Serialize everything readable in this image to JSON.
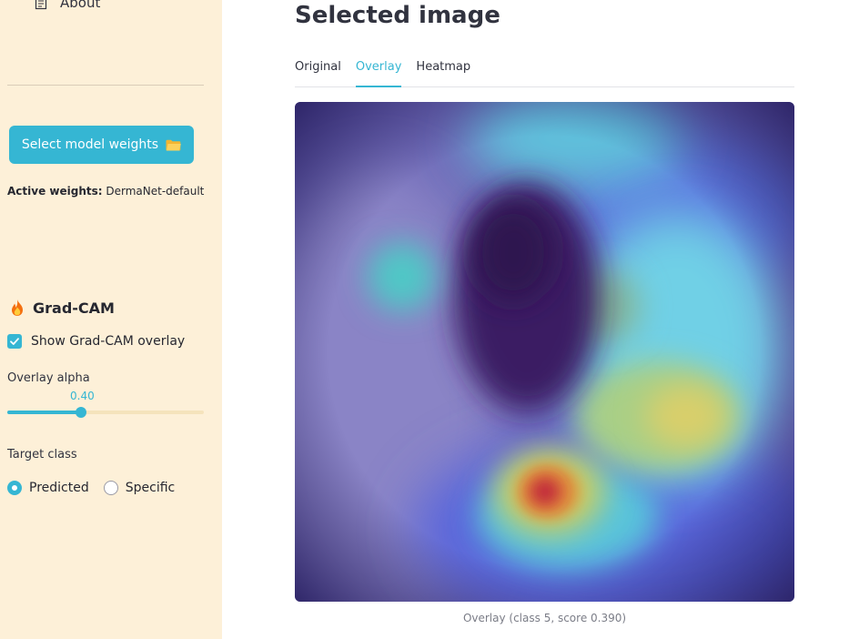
{
  "sidebar": {
    "nav_about": "About",
    "select_weights_label": "Select model weights",
    "active_weights_label": "Active weights:",
    "active_weights_value": "DermaNet-default",
    "gradcam_title": "Grad-CAM",
    "show_overlay_label": "Show Grad-CAM overlay",
    "show_overlay_checked": true,
    "alpha_label": "Overlay alpha",
    "alpha_value": "0.40",
    "alpha_fraction": 0.375,
    "target_class_label": "Target class",
    "target_options": [
      "Predicted",
      "Specific"
    ],
    "target_selected": "Predicted"
  },
  "main": {
    "title": "Selected image",
    "tabs": [
      {
        "label": "Original",
        "active": false
      },
      {
        "label": "Overlay",
        "active": true
      },
      {
        "label": "Heatmap",
        "active": false
      }
    ],
    "caption": "Overlay (class 5, score 0.390)"
  },
  "colors": {
    "accent": "#35b6d3",
    "sidebar_bg": "#fdf0d8"
  }
}
